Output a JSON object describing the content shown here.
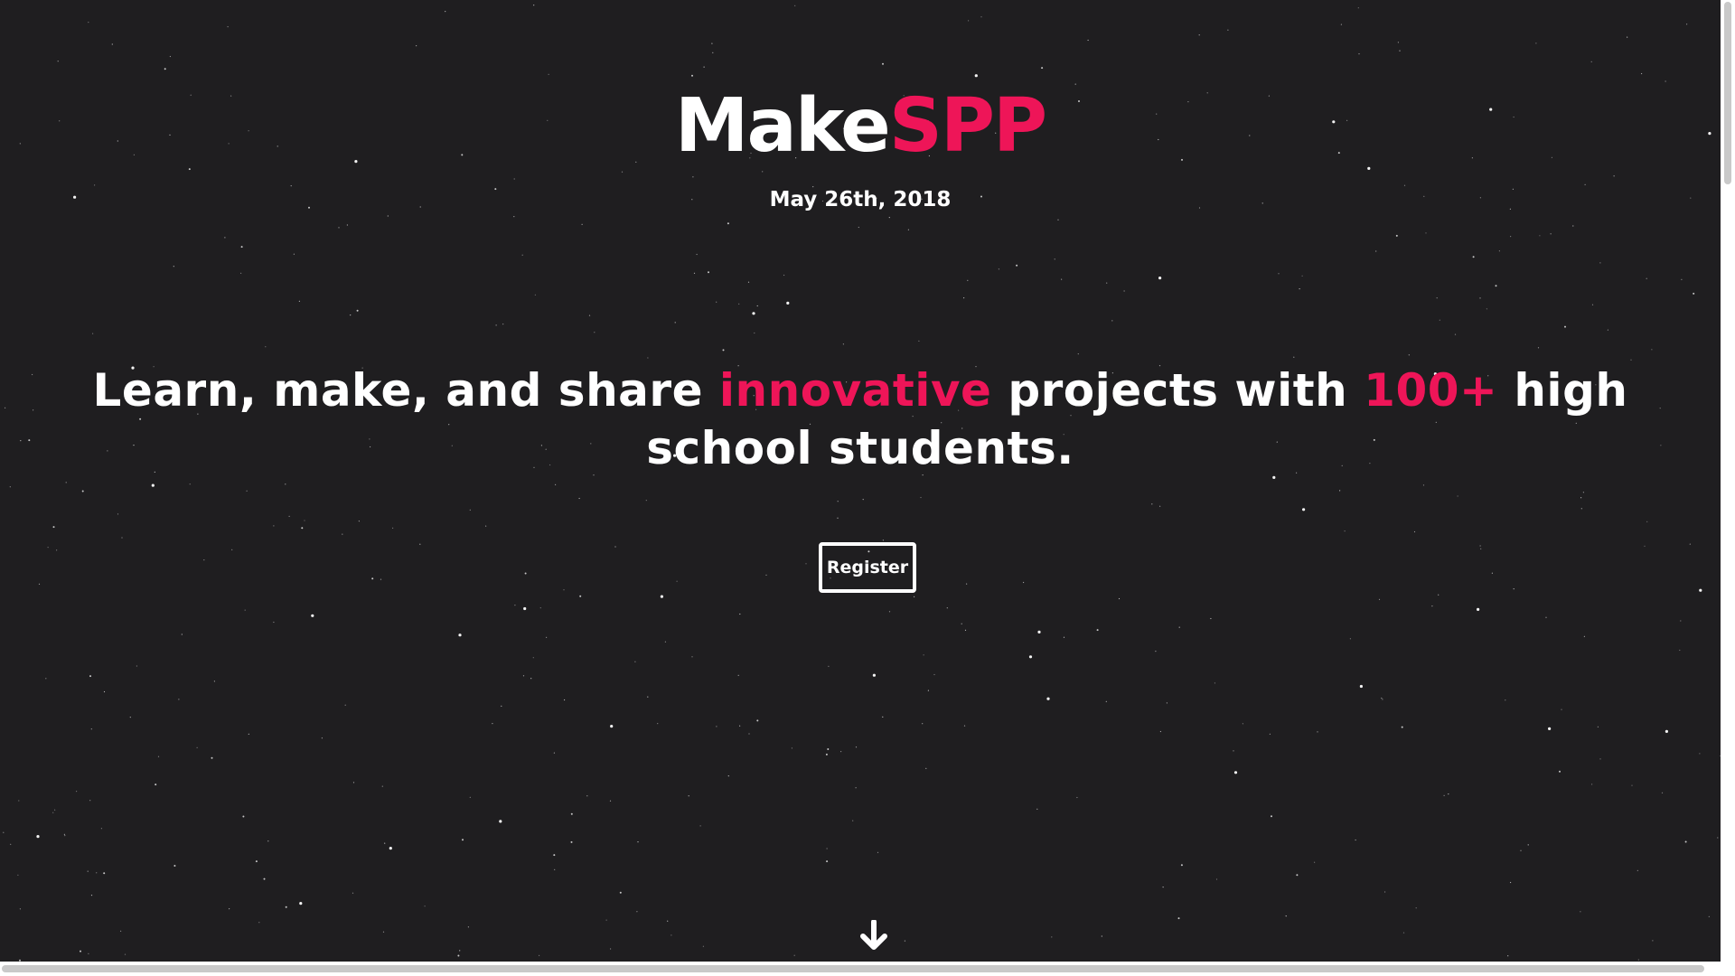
{
  "hero": {
    "brand_main": "Make",
    "brand_accent": "SPP",
    "date": "May 26th, 2018",
    "tagline": {
      "part1": "Learn, make, and share ",
      "highlight1": "innovative",
      "part2": " projects with ",
      "highlight2": "100+",
      "part3": " high school students."
    },
    "register_label": "Register",
    "scroll_icon": "arrow-down-icon"
  },
  "colors": {
    "background": "#1f1e20",
    "accent": "#ee1558",
    "text": "#ffffff"
  }
}
